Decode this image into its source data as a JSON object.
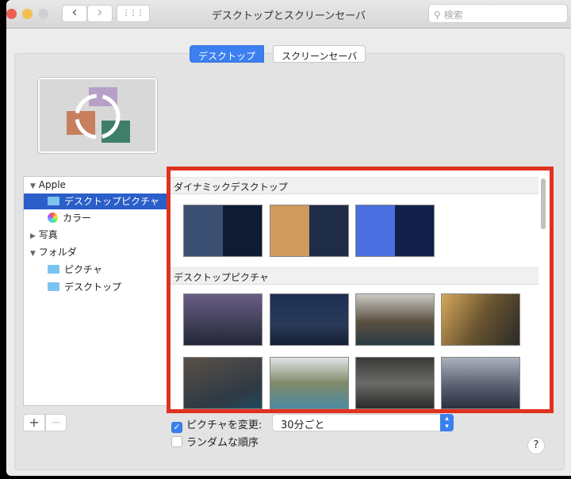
{
  "window": {
    "title": "デスクトップとスクリーンセーバ",
    "search_placeholder": "検索",
    "back": "‹",
    "forward": "›",
    "grid": "⋮⋮⋮"
  },
  "tabs": [
    {
      "label": "デスクトップ",
      "active": true
    },
    {
      "label": "スクリーンセーバ",
      "active": false
    }
  ],
  "sidebar": {
    "items": [
      {
        "label": "Apple",
        "disclosure": "▼"
      },
      {
        "label": "デスクトップピクチャ",
        "selected": true
      },
      {
        "label": "カラー"
      },
      {
        "label": "写真",
        "disclosure": "▶"
      },
      {
        "label": "フォルダ",
        "disclosure": "▼"
      },
      {
        "label": "ピクチャ"
      },
      {
        "label": "デスクトップ"
      }
    ]
  },
  "sections": [
    {
      "title": "ダイナミックデスクトップ"
    },
    {
      "title": "デスクトップピクチャ"
    }
  ],
  "bottom": {
    "add": "+",
    "remove": "−",
    "change_picture_label": "ピクチャを変更:",
    "change_picture_checked": true,
    "interval": "30分ごと",
    "random_label": "ランダムな順序",
    "random_checked": false,
    "help": "?"
  },
  "colors": {
    "accent": "#3b7ff0",
    "highlight": "#e0321f"
  }
}
